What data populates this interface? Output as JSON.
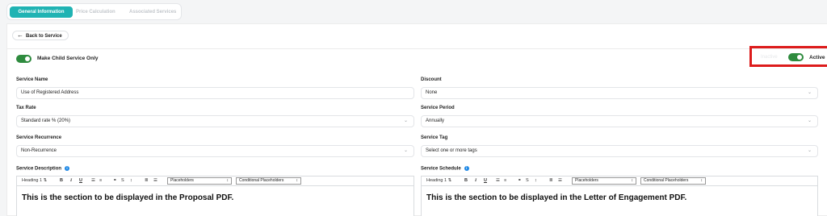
{
  "tabs": [
    {
      "label": "General Information",
      "active": true
    },
    {
      "label": "Price Calculation",
      "active": false
    },
    {
      "label": "Associated Services",
      "active": false
    }
  ],
  "back_button": {
    "label": "Back to Service",
    "icon": "arrow-left-icon"
  },
  "child_service": {
    "label": "Make Child Service Only",
    "on": true
  },
  "status": {
    "inactive_label": "Inactive",
    "active_label": "Active",
    "on": true
  },
  "form": {
    "service_name": {
      "label": "Service Name",
      "value": "Use of Registered Address"
    },
    "discount": {
      "label": "Discount",
      "value": "None"
    },
    "tax_rate": {
      "label": "Tax Rate",
      "value": "Standard rate % (20%)"
    },
    "service_period": {
      "label": "Service Period",
      "value": "Annually"
    },
    "service_recurrence": {
      "label": "Service Recurrence",
      "value": "Non-Recurrence"
    },
    "service_tag": {
      "label": "Service Tag",
      "placeholder": "Select one or more tags"
    }
  },
  "editors": {
    "description": {
      "label": "Service Description",
      "heading": "Heading 1",
      "placeholders": "Placeholders",
      "conditional": "Conditional Placeholders",
      "content": "This is the section to be displayed in the Proposal PDF."
    },
    "schedule": {
      "label": "Service Schedule",
      "heading": "Heading 1",
      "placeholders": "Placeholders",
      "conditional": "Conditional Placeholders",
      "content": "This is the section to be displayed in the Letter of Engagement PDF."
    }
  },
  "toolbar_glyphs": {
    "sort": "⇅",
    "bold": "B",
    "italic": "I",
    "underline": "U",
    "list_bullet": "☰",
    "list_number": "≡",
    "link": "⚭",
    "strike": "S",
    "align": "≡",
    "ordered": "≣",
    "chevron": "⌄",
    "updown": "↕",
    "info": "i"
  },
  "colors": {
    "accent": "#20b3b3",
    "toggle_on": "#2e8b3e",
    "highlight": "#dd1c1c",
    "info": "#1e88e5"
  }
}
